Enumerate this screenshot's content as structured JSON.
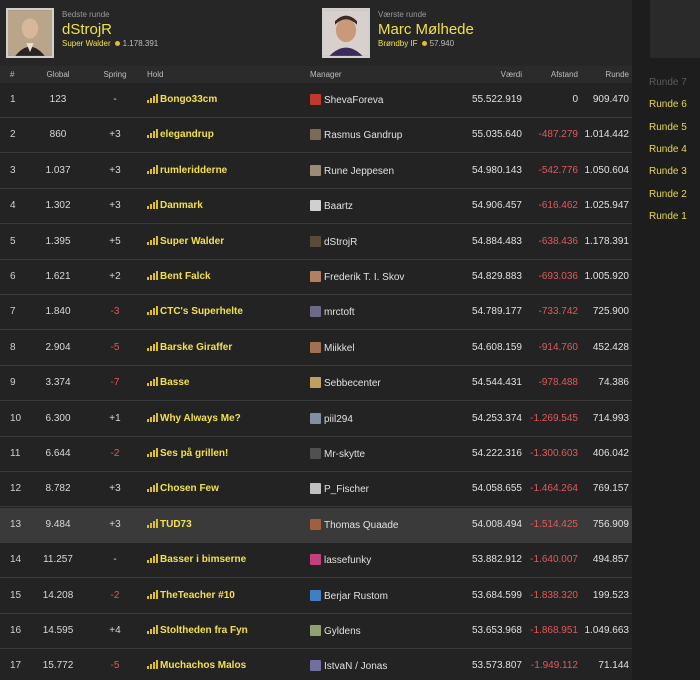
{
  "header": {
    "best": {
      "caption": "Bedste runde",
      "manager": "dStrojR",
      "team": "Super Walder",
      "points": "1.178.391"
    },
    "worst": {
      "caption": "Værste runde",
      "manager": "Marc Mølhede",
      "team": "Brøndby IF",
      "points": "57.940"
    }
  },
  "columns": {
    "rank": "#",
    "global": "Global",
    "spring": "Spring",
    "team": "Hold",
    "manager": "Manager",
    "value": "Værdi",
    "distance": "Afstand",
    "round": "Runde"
  },
  "rows": [
    {
      "rank": "1",
      "global": "123",
      "spring": "-",
      "team": "Bongo33cm",
      "manager": "ShevaForeva",
      "value": "55.522.919",
      "distance": "0",
      "round": "909.470"
    },
    {
      "rank": "2",
      "global": "860",
      "spring": "+3",
      "team": "elegandrup",
      "manager": "Rasmus Gandrup",
      "value": "55.035.640",
      "distance": "-487.279",
      "round": "1.014.442"
    },
    {
      "rank": "3",
      "global": "1.037",
      "spring": "+3",
      "team": "rumleridderne",
      "manager": "Rune Jeppesen",
      "value": "54.980.143",
      "distance": "-542.776",
      "round": "1.050.604"
    },
    {
      "rank": "4",
      "global": "1.302",
      "spring": "+3",
      "team": "Danmark",
      "manager": "Baartz",
      "value": "54.906.457",
      "distance": "-616.462",
      "round": "1.025.947"
    },
    {
      "rank": "5",
      "global": "1.395",
      "spring": "+5",
      "team": "Super Walder",
      "manager": "dStrojR",
      "value": "54.884.483",
      "distance": "-638.436",
      "round": "1.178.391"
    },
    {
      "rank": "6",
      "global": "1.621",
      "spring": "+2",
      "team": "Bent Falck",
      "manager": "Frederik T. I. Skov",
      "value": "54.829.883",
      "distance": "-693.036",
      "round": "1.005.920"
    },
    {
      "rank": "7",
      "global": "1.840",
      "spring": "-3",
      "team": "CTC's Superhelte",
      "manager": "mrctoft",
      "value": "54.789.177",
      "distance": "-733.742",
      "round": "725.900"
    },
    {
      "rank": "8",
      "global": "2.904",
      "spring": "-5",
      "team": "Barske Giraffer",
      "manager": "Miikkel",
      "value": "54.608.159",
      "distance": "-914.760",
      "round": "452.428"
    },
    {
      "rank": "9",
      "global": "3.374",
      "spring": "-7",
      "team": "Basse",
      "manager": "Sebbecenter",
      "value": "54.544.431",
      "distance": "-978.488",
      "round": "74.386"
    },
    {
      "rank": "10",
      "global": "6.300",
      "spring": "+1",
      "team": "Why Always Me?",
      "manager": "piil294",
      "value": "54.253.374",
      "distance": "-1.269.545",
      "round": "714.993"
    },
    {
      "rank": "11",
      "global": "6.644",
      "spring": "-2",
      "team": "Ses på grillen!",
      "manager": "Mr-skytte",
      "value": "54.222.316",
      "distance": "-1.300.603",
      "round": "406.042"
    },
    {
      "rank": "12",
      "global": "8.782",
      "spring": "+3",
      "team": "Chosen Few",
      "manager": "P_Fischer",
      "value": "54.058.655",
      "distance": "-1.464.264",
      "round": "769.157"
    },
    {
      "rank": "13",
      "global": "9.484",
      "spring": "+3",
      "team": "TUD73",
      "manager": "Thomas Quaade",
      "value": "54.008.494",
      "distance": "-1.514.425",
      "round": "756.909"
    },
    {
      "rank": "14",
      "global": "11.257",
      "spring": "-",
      "team": "Basser i bimserne",
      "manager": "lassefunky",
      "value": "53.882.912",
      "distance": "-1.640.007",
      "round": "494.857"
    },
    {
      "rank": "15",
      "global": "14.208",
      "spring": "-2",
      "team": "TheTeacher #10",
      "manager": "Berjar Rustom",
      "value": "53.684.599",
      "distance": "-1.838.320",
      "round": "199.523"
    },
    {
      "rank": "16",
      "global": "14.595",
      "spring": "+4",
      "team": "Stoltheden fra Fyn",
      "manager": "Gyldens",
      "value": "53.653.968",
      "distance": "-1.868.951",
      "round": "1.049.663"
    },
    {
      "rank": "17",
      "global": "15.772",
      "spring": "-5",
      "team": "Muchachos Malos",
      "manager": "IstvaN / Jonas",
      "value": "53.573.807",
      "distance": "-1.949.112",
      "round": "71.144"
    }
  ],
  "highlighted_rank": "13",
  "rounds": [
    "Runde 7",
    "Runde 6",
    "Runde 5",
    "Runde 4",
    "Runde 3",
    "Runde 2",
    "Runde 1"
  ],
  "rounds_dimmed": [
    "Runde 7"
  ],
  "colors": {
    "accent_yellow": "#f2e04a",
    "negative_red": "#e05a5a",
    "background": "#232323",
    "highlight_row": "#3a3a3a"
  }
}
